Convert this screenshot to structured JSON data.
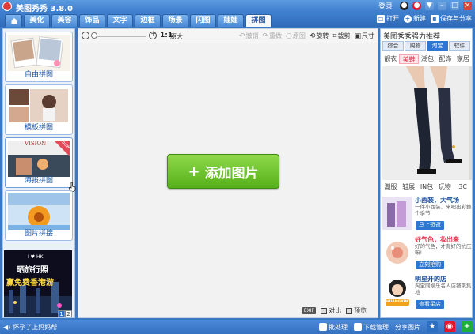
{
  "app": {
    "title": "美图秀秀 3.8.0"
  },
  "titlebar": {
    "login": "登录"
  },
  "menu": {
    "tabs": [
      "美化",
      "美容",
      "饰品",
      "文字",
      "边框",
      "场景",
      "闪图",
      "娃娃",
      "拼图"
    ],
    "active_tab": "拼图",
    "open": "打开",
    "new": "新建",
    "save_share": "保存与分享"
  },
  "left": {
    "modes": [
      {
        "label": "自由拼图"
      },
      {
        "label": "模板拼图"
      },
      {
        "label": "海报拼图",
        "badge": "new",
        "thumb_text": "VISION"
      },
      {
        "label": "图片拼接"
      }
    ],
    "ad": {
      "line1": "晒旅行照",
      "line2": "赢免费香港游",
      "small": "I ♥ HK",
      "pages": [
        "1",
        "2"
      ]
    }
  },
  "toolbar": {
    "zoom_one": "1:1",
    "zoom_orig": "原大",
    "undo": "撤销",
    "redo": "重做",
    "original": "原图",
    "rotate": "旋转",
    "crop": "裁剪",
    "size": "尺寸"
  },
  "workspace": {
    "add_button": "添加图片",
    "exif": "EXIF",
    "compare": "对比",
    "preview": "预览"
  },
  "right": {
    "title": "美图秀秀强力推荐",
    "tabs": [
      "综合",
      "购物",
      "淘宝",
      "软件"
    ],
    "active_tab": "淘宝",
    "cats_top": [
      "靓衣",
      "美鞋",
      "潮包",
      "配饰",
      "家居"
    ],
    "active_cat": "美鞋",
    "cats_bottom": [
      "潮服",
      "鞋展",
      "IN包",
      "玩物",
      "3C"
    ],
    "shops": [
      {
        "name": "小西装，大气场",
        "desc": "一件小西装，来吧出彩整个季节",
        "button": "马上逛逛"
      },
      {
        "name": "好气色，妆出来",
        "desc": "好的气色，才有好的抗压嘛!",
        "button": "立刻抢购"
      },
      {
        "name": "明星开的店",
        "desc": "淘宝网娱乐名人店铺聚集地",
        "button": "查看星店",
        "logo": "HUANGXIN"
      }
    ]
  },
  "status": {
    "left_text": "怀孕了上妈妈帮",
    "batch": "批处理",
    "download": "下载管理",
    "share": "分享图片"
  },
  "colors": {
    "accent": "#3d7ccc",
    "add_button": "#6cc42b",
    "highlight": "#e2334a"
  }
}
